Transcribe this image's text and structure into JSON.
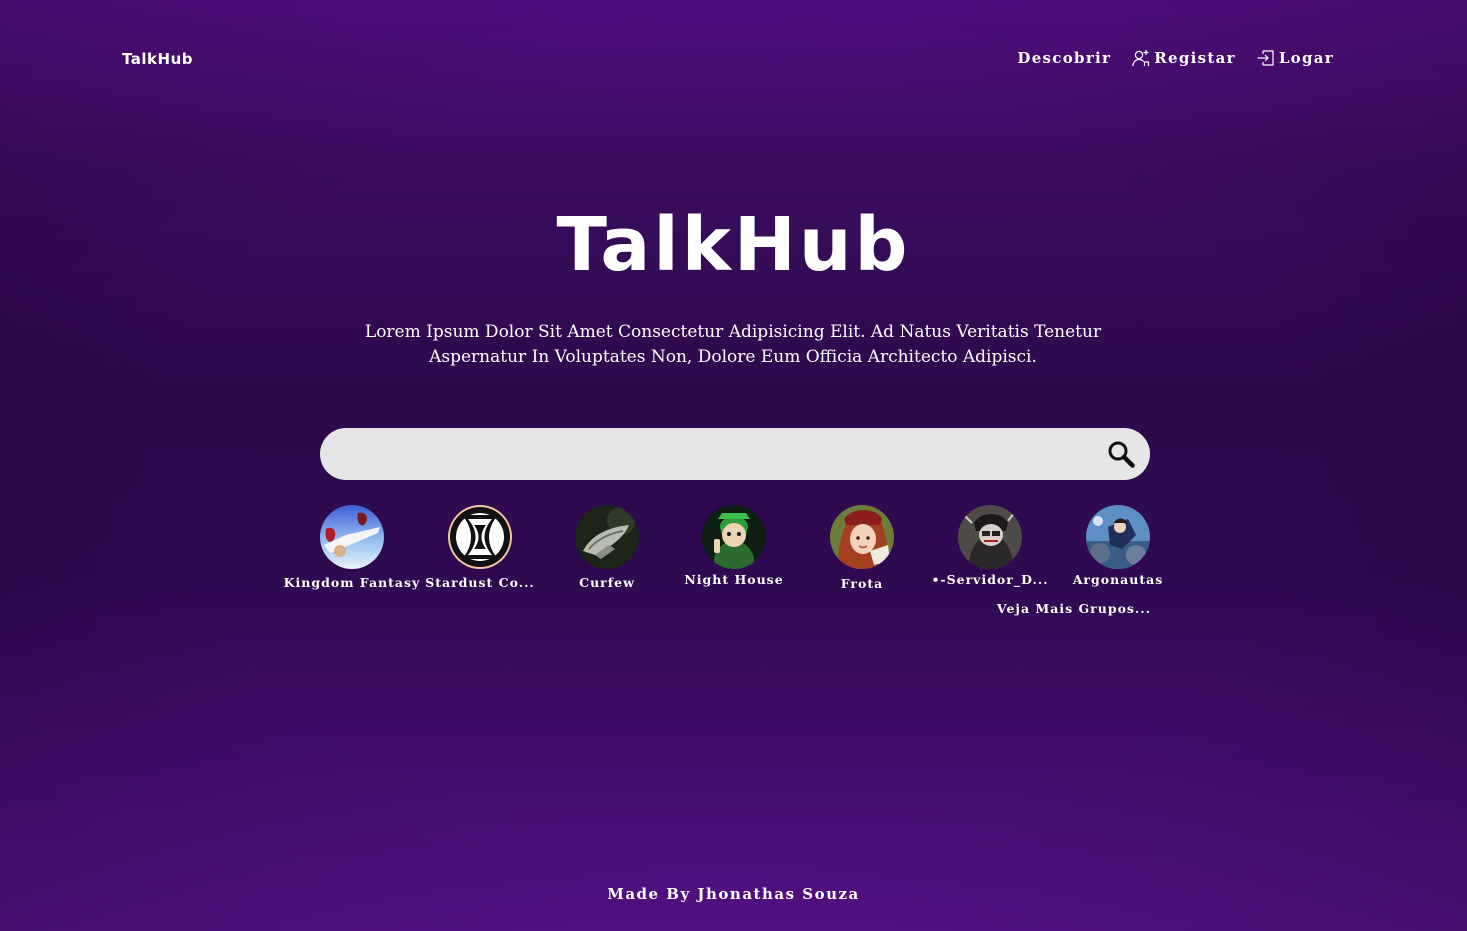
{
  "brand": {
    "logo_text": "TalkHub"
  },
  "nav": {
    "items": [
      {
        "label": "Descobrir",
        "icon": ""
      },
      {
        "label": "Registar",
        "icon": "add-user-icon"
      },
      {
        "label": "Logar",
        "icon": "login-icon"
      }
    ]
  },
  "hero": {
    "title": "TalkHub",
    "description": "Lorem Ipsum Dolor Sit Amet Consectetur Adipisicing Elit. Ad Natus Veritatis Tenetur Aspernatur In Voluptates Non, Dolore Eum Officia Architecto Adipisci."
  },
  "search": {
    "placeholder": "",
    "value": "",
    "icon": "search-icon"
  },
  "groups": [
    {
      "name": "Kingdom Fantasy"
    },
    {
      "name": "Stardust Co..."
    },
    {
      "name": "Curfew"
    },
    {
      "name": "Night House"
    },
    {
      "name": "Frota"
    },
    {
      "name": "•-Servidor_D..."
    },
    {
      "name": "Argonautas"
    }
  ],
  "more_link": "Veja Mais Grupos...",
  "footer": {
    "text": "Made By Jhonathas Souza"
  },
  "colors": {
    "background_top": "#560e86",
    "background_middle": "#2e0a4c",
    "search_background": "#e6e6e6",
    "text": "#ffffff"
  }
}
